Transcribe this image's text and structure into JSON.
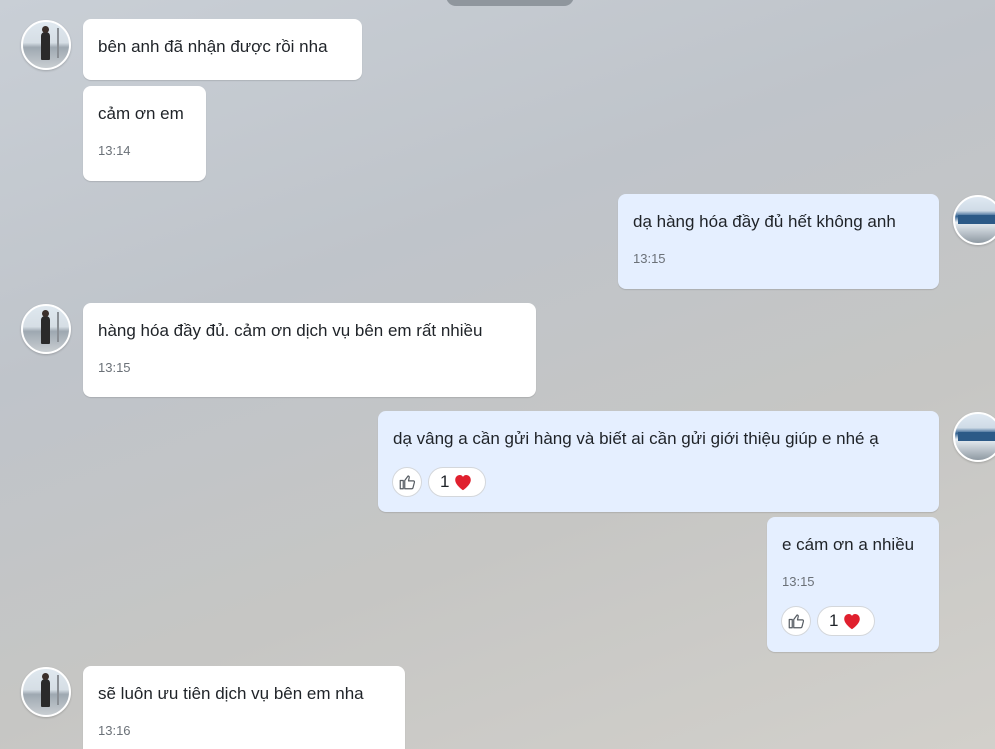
{
  "messages": [
    {
      "sender": "them",
      "text": "bên anh đã nhận được rồi nha",
      "time": ""
    },
    {
      "sender": "them",
      "text": "cảm ơn em",
      "time": "13:14"
    },
    {
      "sender": "me",
      "text": "dạ hàng hóa đầy đủ hết không anh",
      "time": "13:15"
    },
    {
      "sender": "them",
      "text": "hàng hóa đầy đủ. cảm ơn dịch vụ bên em rất nhiều",
      "time": "13:15"
    },
    {
      "sender": "me",
      "text": "dạ vâng a cần gửi hàng và biết ai cần gửi giới thiệu giúp e nhé ạ",
      "time": "",
      "reaction": {
        "count": "1",
        "emoji": "heart"
      }
    },
    {
      "sender": "me",
      "text": "e cám ơn a nhiều",
      "time": "13:15",
      "reaction": {
        "count": "1",
        "emoji": "heart"
      }
    },
    {
      "sender": "them",
      "text": "sẽ luôn ưu tiên dịch vụ bên em nha",
      "time": "13:16"
    }
  ],
  "colors": {
    "bubble_incoming": "#ffffff",
    "bubble_outgoing": "#e5efff",
    "heart": "#e0202e"
  },
  "icons": {
    "like": "thumbs-up-icon",
    "reaction": "heart-icon"
  }
}
